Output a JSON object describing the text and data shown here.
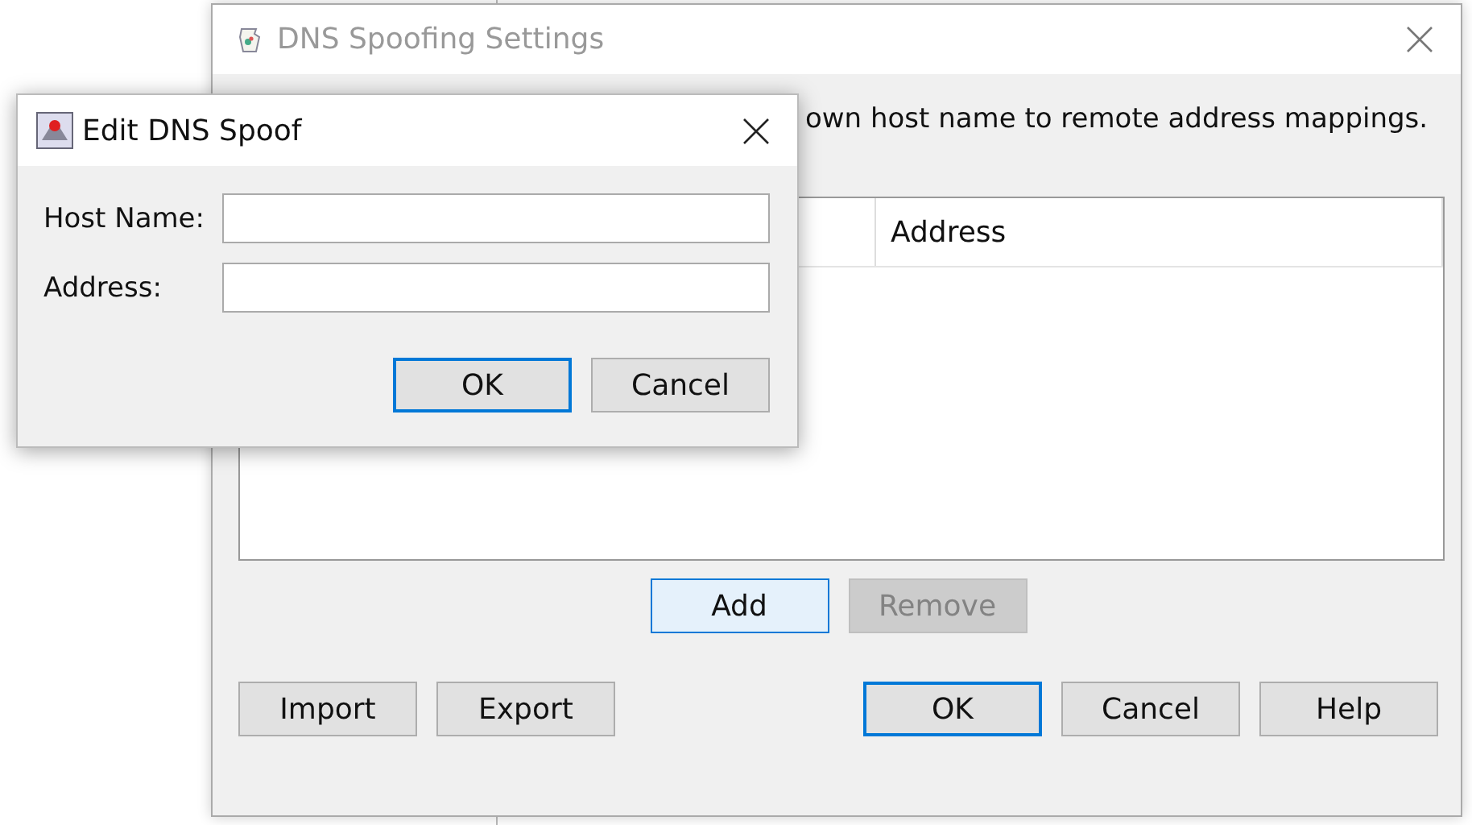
{
  "settings_window": {
    "title": "DNS Spoofing Settings",
    "active": false,
    "description": "own host name to remote address mappings.",
    "table": {
      "columns": [
        "Address"
      ]
    },
    "table_buttons": [
      {
        "label": "Add",
        "highlighted": true,
        "disabled": false,
        "default": false
      },
      {
        "label": "Remove",
        "highlighted": false,
        "disabled": true,
        "default": false
      }
    ],
    "left_buttons": [
      {
        "label": "Import",
        "highlighted": false,
        "disabled": false,
        "default": false
      },
      {
        "label": "Export",
        "highlighted": false,
        "disabled": false,
        "default": false
      }
    ],
    "right_buttons": [
      {
        "label": "OK",
        "highlighted": false,
        "disabled": false,
        "default": true
      },
      {
        "label": "Cancel",
        "highlighted": false,
        "disabled": false,
        "default": false
      },
      {
        "label": "Help",
        "highlighted": false,
        "disabled": false,
        "default": false
      }
    ]
  },
  "edit_dialog": {
    "title": "Edit DNS Spoof",
    "active": true,
    "fields": [
      {
        "label": "Host Name:"
      },
      {
        "label": "Address:"
      }
    ],
    "buttons": [
      {
        "label": "OK",
        "highlighted": false,
        "disabled": false,
        "default": true
      },
      {
        "label": "Cancel",
        "highlighted": false,
        "disabled": false,
        "default": false
      }
    ]
  }
}
